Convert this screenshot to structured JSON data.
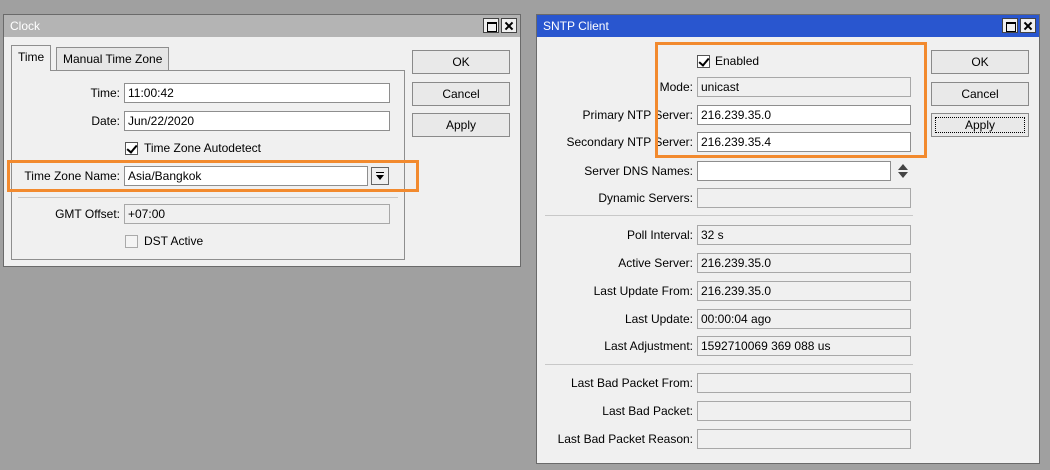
{
  "clock": {
    "title": "Clock",
    "tabs": [
      "Time",
      "Manual Time Zone"
    ],
    "time_label": "Time:",
    "time_value": "11:00:42",
    "date_label": "Date:",
    "date_value": "Jun/22/2020",
    "autodetect_label": "Time Zone Autodetect",
    "autodetect_checked": true,
    "tz_label": "Time Zone Name:",
    "tz_value": "Asia/Bangkok",
    "gmt_label": "GMT Offset:",
    "gmt_value": "+07:00",
    "dst_label": "DST Active",
    "dst_checked": false,
    "buttons": {
      "ok": "OK",
      "cancel": "Cancel",
      "apply": "Apply"
    }
  },
  "sntp": {
    "title": "SNTP Client",
    "enabled_label": "Enabled",
    "enabled_checked": true,
    "mode_label": "Mode:",
    "mode_value": "unicast",
    "primary_label": "Primary NTP Server:",
    "primary_value": "216.239.35.0",
    "secondary_label": "Secondary NTP Server:",
    "secondary_value": "216.239.35.4",
    "dns_label": "Server DNS Names:",
    "dns_value": "",
    "dynamic_label": "Dynamic Servers:",
    "dynamic_value": "",
    "poll_label": "Poll Interval:",
    "poll_value": "32 s",
    "active_label": "Active Server:",
    "active_value": "216.239.35.0",
    "lastfrom_label": "Last Update From:",
    "lastfrom_value": "216.239.35.0",
    "lastupdate_label": "Last Update:",
    "lastupdate_value": "00:00:04 ago",
    "lastadj_label": "Last Adjustment:",
    "lastadj_value": "1592710069 369 088 us",
    "badfrom_label": "Last Bad Packet From:",
    "badfrom_value": "",
    "bad_label": "Last Bad Packet:",
    "bad_value": "",
    "badreason_label": "Last Bad Packet Reason:",
    "badreason_value": "",
    "buttons": {
      "ok": "OK",
      "cancel": "Cancel",
      "apply": "Apply"
    }
  },
  "colors": {
    "highlight": "#f28a2e",
    "active_title": "#2956cf",
    "inactive_title": "#b4b4b4"
  },
  "icons": [
    "maximize-icon",
    "close-icon",
    "dropdown-icon",
    "spinner-icon",
    "checkbox"
  ]
}
